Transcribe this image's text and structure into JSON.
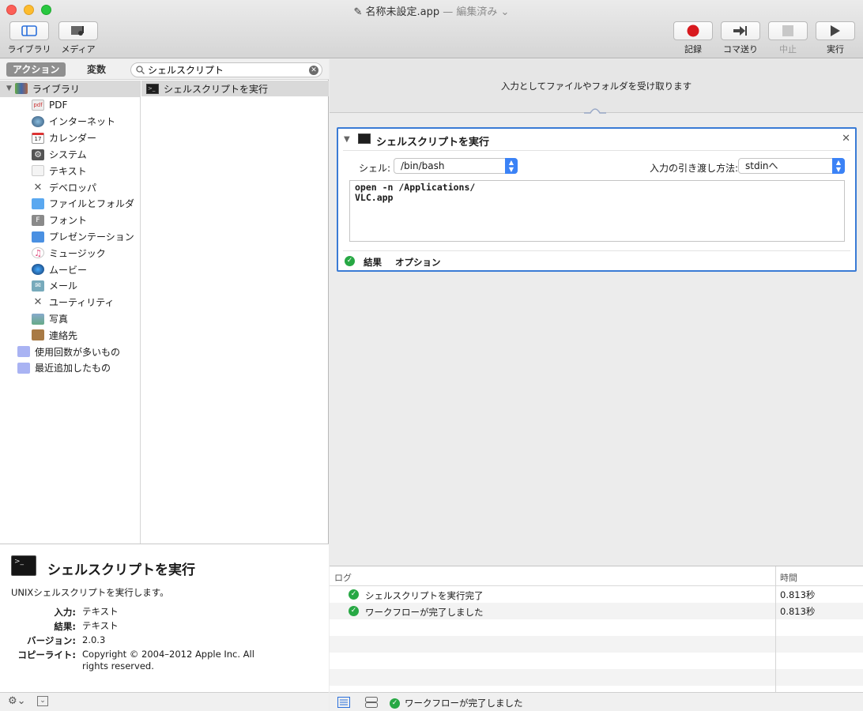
{
  "window": {
    "title": "名称未設定.app",
    "subtitle": "— 編集済み ⌄"
  },
  "toolbar": {
    "library_label": "ライブラリ",
    "media_label": "メディア",
    "record_label": "記録",
    "step_label": "コマ送り",
    "stop_label": "中止",
    "run_label": "実行"
  },
  "library_pane": {
    "tabs": [
      "アクション",
      "変数"
    ],
    "search_value": "シェルスクリプト",
    "items": [
      {
        "label": "ライブラリ",
        "icon": "library-icon"
      },
      {
        "label": "PDF",
        "icon": "pdf-icon"
      },
      {
        "label": "インターネット",
        "icon": "globe-icon"
      },
      {
        "label": "カレンダー",
        "icon": "calendar-icon"
      },
      {
        "label": "システム",
        "icon": "system-icon"
      },
      {
        "label": "テキスト",
        "icon": "text-icon"
      },
      {
        "label": "デベロッパ",
        "icon": "developer-icon"
      },
      {
        "label": "ファイルとフォルダ",
        "icon": "folder-icon"
      },
      {
        "label": "フォント",
        "icon": "font-icon"
      },
      {
        "label": "プレゼンテーション",
        "icon": "presentation-icon"
      },
      {
        "label": "ミュージック",
        "icon": "music-icon"
      },
      {
        "label": "ムービー",
        "icon": "movie-icon"
      },
      {
        "label": "メール",
        "icon": "mail-icon"
      },
      {
        "label": "ユーティリティ",
        "icon": "utility-icon"
      },
      {
        "label": "写真",
        "icon": "photo-icon"
      },
      {
        "label": "連絡先",
        "icon": "contacts-icon"
      },
      {
        "label": "使用回数が多いもの",
        "icon": "smart-folder-icon"
      },
      {
        "label": "最近追加したもの",
        "icon": "smart-folder-icon"
      }
    ],
    "action_result": "シェルスクリプトを実行"
  },
  "info": {
    "title": "シェルスクリプトを実行",
    "description": "UNIXシェルスクリプトを実行します。",
    "input_key": "入力:",
    "input_val": "テキスト",
    "result_key": "結果:",
    "result_val": "テキスト",
    "version_key": "バージョン:",
    "version_val": "2.0.3",
    "copyright_key": "コピーライト:",
    "copyright_val": "Copyright © 2004–2012 Apple Inc.  All rights reserved."
  },
  "workflow": {
    "input_banner": "入力としてファイルやフォルダを受け取ります",
    "action": {
      "title": "シェルスクリプトを実行",
      "shell_label": "シェル:",
      "shell_value": "/bin/bash",
      "pass_label": "入力の引き渡し方法:",
      "pass_value": "stdinへ",
      "script": "open -n /Applications/\nVLC.app",
      "tab_results": "結果",
      "tab_options": "オプション"
    }
  },
  "log": {
    "col_log": "ログ",
    "col_time": "時間",
    "rows": [
      {
        "msg": "シェルスクリプトを実行完了",
        "time": "0.813秒"
      },
      {
        "msg": "ワークフローが完了しました",
        "time": "0.813秒"
      }
    ],
    "status": "ワークフローが完了しました"
  },
  "colors": {
    "accent": "#3a7bd5",
    "success": "#27a844",
    "record": "#d8191e"
  }
}
